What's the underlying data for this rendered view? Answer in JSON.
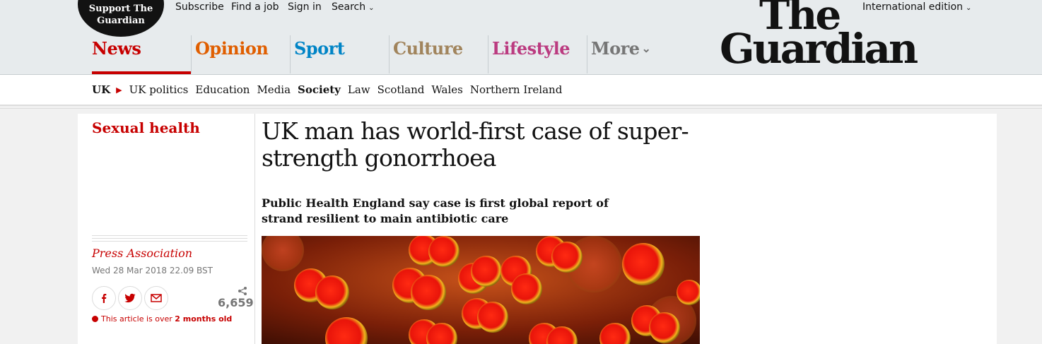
{
  "header": {
    "support_line1": "Support The",
    "support_line2": "Guardian",
    "top_links": [
      "Subscribe",
      "Find a job",
      "Sign in",
      "Search"
    ],
    "edition": "International edition",
    "logo_line1": "The",
    "logo_line2": "Guardian",
    "pillars": [
      {
        "label": "News",
        "color": "#c70000"
      },
      {
        "label": "Opinion",
        "color": "#e05e00"
      },
      {
        "label": "Sport",
        "color": "#0084c6"
      },
      {
        "label": "Culture",
        "color": "#a1845c"
      },
      {
        "label": "Lifestyle",
        "color": "#bb3b80"
      },
      {
        "label": "More",
        "color": "#767676"
      }
    ]
  },
  "subnav": {
    "items": [
      "UK",
      "UK politics",
      "Education",
      "Media",
      "Society",
      "Law",
      "Scotland",
      "Wales",
      "Northern Ireland"
    ]
  },
  "article": {
    "section": "Sexual health",
    "headline": "UK man has world-first case of super-strength gonorrhoea",
    "standfirst": "Public Health England say case is first global report of strand resilient to main antibiotic care",
    "byline": "Press Association",
    "date": "Wed 28 Mar 2018 22.09 BST",
    "share_count": "6,659",
    "age_prefix": "This article is over ",
    "age_value": "2 months old"
  }
}
